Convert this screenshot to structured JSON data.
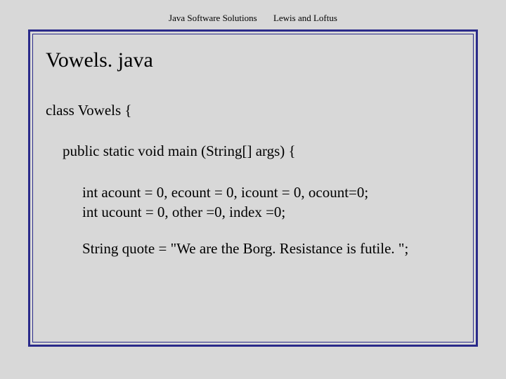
{
  "header": {
    "left": "Java Software Solutions",
    "right": "Lewis and Loftus"
  },
  "title": "Vowels. java",
  "code": {
    "line1": "class Vowels {",
    "line2": "public static void main (String[] args) {",
    "line3": "int acount = 0, ecount = 0, icount = 0, ocount=0;",
    "line4": "int ucount = 0, other =0, index =0;",
    "line5": "String quote = \"We are the Borg.  Resistance is futile. \";"
  }
}
